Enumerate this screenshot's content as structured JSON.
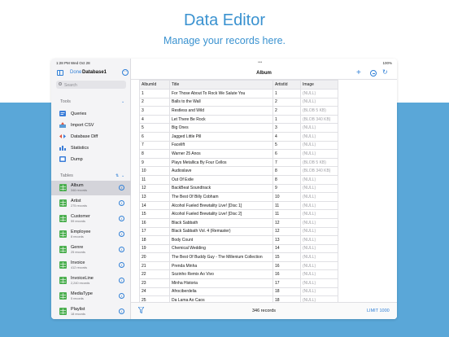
{
  "hero": {
    "title": "Data Editor",
    "subtitle": "Manage your records here."
  },
  "statusbar": {
    "time": "1:28 PM   Wed Oct 28",
    "battery": "100%"
  },
  "sidebar": {
    "done_label": "Done",
    "database_name": "Database1",
    "search_placeholder": "Search",
    "tools_title": "Tools",
    "tools": [
      {
        "label": "Queries",
        "icon": "queries-icon"
      },
      {
        "label": "Import CSV",
        "icon": "import-csv-icon"
      },
      {
        "label": "Database Diff",
        "icon": "database-diff-icon"
      },
      {
        "label": "Statistics",
        "icon": "statistics-icon"
      },
      {
        "label": "Dump",
        "icon": "dump-icon"
      }
    ],
    "tables_title": "Tables",
    "tables": [
      {
        "name": "Album",
        "count": "346 records"
      },
      {
        "name": "Artist",
        "count": "275 records"
      },
      {
        "name": "Customer",
        "count": "59 records"
      },
      {
        "name": "Employee",
        "count": "8 records"
      },
      {
        "name": "Genre",
        "count": "25 records"
      },
      {
        "name": "Invoice",
        "count": "412 records"
      },
      {
        "name": "InvoiceLine",
        "count": "2,240 records"
      },
      {
        "name": "MediaType",
        "count": "5 records"
      },
      {
        "name": "Playlist",
        "count": "18 records"
      }
    ]
  },
  "main": {
    "title": "Album",
    "columns": [
      "AlbumId",
      "Title",
      "ArtistId",
      "Image"
    ],
    "rows": [
      [
        "1",
        "For Those About To Rock We Salute You",
        "1",
        "(NULL)"
      ],
      [
        "2",
        "Balls to the Wall",
        "2",
        "(NULL)"
      ],
      [
        "3",
        "Restless and Wild",
        "2",
        "(BLOB 5 KB)"
      ],
      [
        "4",
        "Let There Be Rock",
        "1",
        "(BLOB 340 KB)"
      ],
      [
        "5",
        "Big Ones",
        "3",
        "(NULL)"
      ],
      [
        "6",
        "Jagged Little Pill",
        "4",
        "(NULL)"
      ],
      [
        "7",
        "Facelift",
        "5",
        "(NULL)"
      ],
      [
        "8",
        "Warner 25 Anos",
        "6",
        "(NULL)"
      ],
      [
        "9",
        "Plays Metallica By Four Cellos",
        "7",
        "(BLOB 5 KB)"
      ],
      [
        "10",
        "Audioslave",
        "8",
        "(BLOB 340 KB)"
      ],
      [
        "11",
        "Out Of Exile",
        "8",
        "(NULL)"
      ],
      [
        "12",
        "BackBeat Soundtrack",
        "9",
        "(NULL)"
      ],
      [
        "13",
        "The Best Of Billy Cobham",
        "10",
        "(NULL)"
      ],
      [
        "14",
        "Alcohol Fueled Brewtality Live! [Disc 1]",
        "11",
        "(NULL)"
      ],
      [
        "15",
        "Alcohol Fueled Brewtality Live! [Disc 2]",
        "11",
        "(NULL)"
      ],
      [
        "16",
        "Black Sabbath",
        "12",
        "(NULL)"
      ],
      [
        "17",
        "Black Sabbath Vol. 4 (Remaster)",
        "12",
        "(NULL)"
      ],
      [
        "18",
        "Body Count",
        "13",
        "(NULL)"
      ],
      [
        "19",
        "Chemical Wedding",
        "14",
        "(NULL)"
      ],
      [
        "20",
        "The Best Of Buddy Guy - The Millenium Collection",
        "15",
        "(NULL)"
      ],
      [
        "21",
        "Prenda Minha",
        "16",
        "(NULL)"
      ],
      [
        "22",
        "Sozinho Remix Ao Vivo",
        "16",
        "(NULL)"
      ],
      [
        "23",
        "Minha Historia",
        "17",
        "(NULL)"
      ],
      [
        "24",
        "Afrociberdelia",
        "18",
        "(NULL)"
      ],
      [
        "25",
        "Da Lama Ao Caos",
        "18",
        "(NULL)"
      ]
    ],
    "footer": {
      "records": "346 records",
      "limit": "LIMIT 1000"
    }
  },
  "colors": {
    "accent": "#2f7fd6",
    "hero_text": "#3a92d0",
    "background_band": "#5aa7d8",
    "table_icon": "#4caf50"
  }
}
